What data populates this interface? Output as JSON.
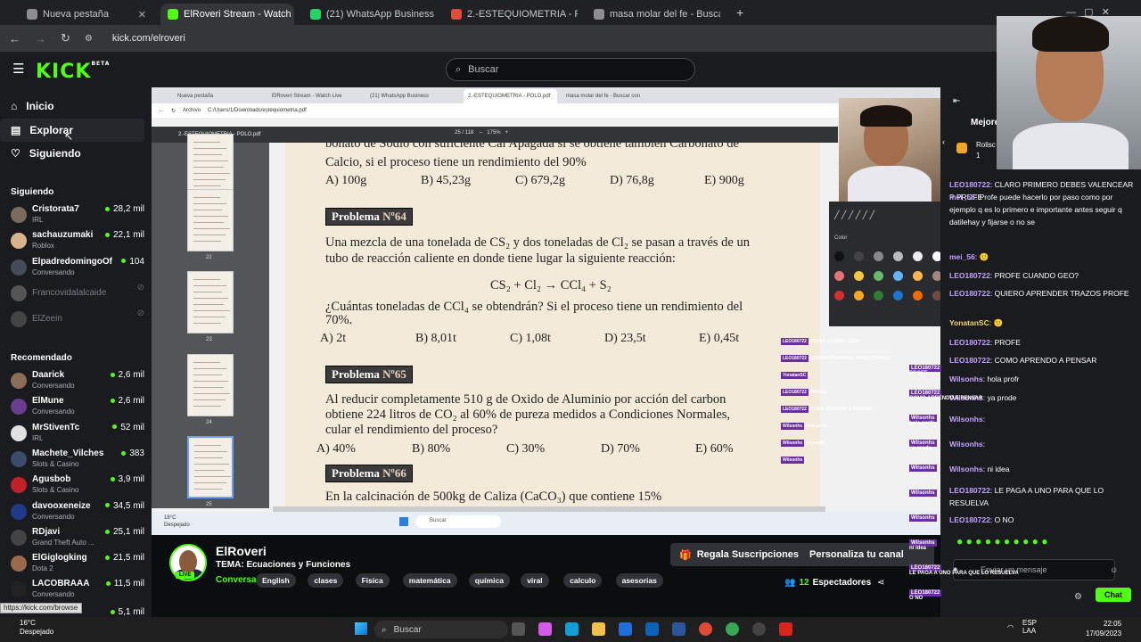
{
  "browser": {
    "tabs": [
      {
        "label": "Nueva pestaña",
        "color": "#8e8e8e"
      },
      {
        "label": "ElRoveri Stream - Watch Liv",
        "color": "#53fc18",
        "active": true
      },
      {
        "label": "(21) WhatsApp Business",
        "color": "#25d366"
      },
      {
        "label": "2.-ESTEQUIOMETRIA - POLO.pd",
        "color": "#e04b3a"
      },
      {
        "label": "masa molar del fe - Buscar con",
        "color": "#8e8e8e"
      }
    ],
    "url": "kick.com/elroveri"
  },
  "kick": {
    "logo": "KICK",
    "logo_beta": "BETA",
    "search_placeholder": "Buscar"
  },
  "sidebar": {
    "nav": [
      {
        "label": "Inicio"
      },
      {
        "label": "Explorar"
      },
      {
        "label": "Siguiendo"
      }
    ],
    "following_header": "Siguiendo",
    "following": [
      {
        "name": "Cristorata7",
        "cat": "IRL",
        "viewers": "28,2 mil",
        "color": "#7b6b5f"
      },
      {
        "name": "sachauzumaki",
        "cat": "Roblox",
        "viewers": "22,1 mil",
        "color": "#d8b38c"
      },
      {
        "name": "ElpadredomingoOf...",
        "cat": "Conversando",
        "viewers": "104",
        "color": "#444c5c"
      },
      {
        "name": "Francovidalalcaide",
        "offline": true,
        "color": "#555"
      },
      {
        "name": "ElZeein",
        "offline": true,
        "color": "#444"
      }
    ],
    "recommended_header": "Recomendado",
    "recommended": [
      {
        "name": "Daarick",
        "cat": "Conversando",
        "viewers": "2,6 mil",
        "color": "#8a6e58"
      },
      {
        "name": "ElMune",
        "cat": "Conversando",
        "viewers": "2,6 mil",
        "color": "#6b3d8e"
      },
      {
        "name": "MrStivenTc",
        "cat": "IRL",
        "viewers": "52 mil",
        "color": "#e0e0e0"
      },
      {
        "name": "Machete_Vilches",
        "cat": "Slots & Casino",
        "viewers": "383",
        "color": "#3a4c6a"
      },
      {
        "name": "Agusbob",
        "cat": "Slots & Casino",
        "viewers": "3,9 mil",
        "color": "#c3202a"
      },
      {
        "name": "davooxeneize",
        "cat": "Conversando",
        "viewers": "34,5 mil",
        "color": "#203a8a"
      },
      {
        "name": "RDjavi",
        "cat": "Grand Theft Auto ...",
        "viewers": "25,1 mil",
        "color": "#444"
      },
      {
        "name": "ElGiglogking",
        "cat": "Dota 2",
        "viewers": "21,5 mil",
        "color": "#9c6a4a"
      },
      {
        "name": "LACOBRAAA",
        "cat": "Conversando",
        "viewers": "11,5 mil",
        "color": "#222"
      }
    ],
    "cut_viewers": "5,1 mil",
    "status_url": "https://kick.com/browse"
  },
  "stream_screen": {
    "inner_tabs": [
      {
        "label": "Nueva pestaña"
      },
      {
        "label": "ElRoveri Stream - Watch Live"
      },
      {
        "label": "(21) WhatsApp Business"
      },
      {
        "label": "2.-ESTEQUIOMETRIA - POLO.pdf",
        "active": true
      },
      {
        "label": "masa molar del fe - Buscar con"
      }
    ],
    "inner_url": "C:/Users/1/Downloads/estequiometria.pdf",
    "inner_url_prefix": "Archivo",
    "pdf_title": "2.-ESTEQUIOMETRIA - POLO.pdf",
    "pdf_page": "25 / 118",
    "pdf_zoom": "175%",
    "thumb_numbers": [
      "21",
      "22",
      "23",
      "24",
      "25"
    ],
    "doc": {
      "line0": "bonato de Sodio con suficiente Cal Apagada si se obtiene también Carbonato de",
      "line1": "Calcio, si el proceso tiene un rendimiento del 90%",
      "ans1": [
        "A) 100g",
        "B) 45,23g",
        "C) 679,2g",
        "D) 76,8g",
        "E) 900g"
      ],
      "p64": {
        "label": "Problema",
        "num": "Nº64"
      },
      "p64_l1": "Una mezcla de una tonelada de CS₂ y dos toneladas de Cl₂ se pasan a través de un",
      "p64_l2": "tubo de reacción caliente en donde tiene lugar la siguiente reacción:",
      "reaction": "CS₂ + Cl₂  →  CCl₄ + S₂",
      "p64_l3": "¿Cuántas toneladas de CCl₄ se obtendrán? Si el proceso tiene un rendimiento del",
      "p64_l4": "70%.",
      "ans2": [
        "A) 2t",
        "B) 8,01t",
        "C) 1,08t",
        "D) 23,5t",
        "E) 0,45t"
      ],
      "p65": {
        "label": "Problema",
        "num": "Nº65"
      },
      "p65_l1": "Al reducir completamente 510 g de Oxido de Aluminio por acción del carbon",
      "p65_l2": "obtiene 224 litros de CO₂ al 60% de pureza medidos a Condiciones Normales,",
      "p65_l3": "cular el rendimiento del proceso?",
      "ans3": [
        "A) 40%",
        "B) 80%",
        "C) 30%",
        "D) 70%",
        "E) 60%"
      ],
      "p66": {
        "label": "Problema",
        "num": "Nº66"
      },
      "p66_l1": "En la calcinación de 500kg de Caliza (CaCO₃) que contiene 15%"
    },
    "color_label": "Color",
    "overlay_chat": [
      {
        "u": "LEO180722",
        "t": "PROFE CUANDO GEO?"
      },
      {
        "u": "LEO180722",
        "t": "QUIERO APRENDER TRAZOS PROFE"
      },
      {
        "u": "YonatanSC",
        "t": ""
      },
      {
        "u": "LEO180722",
        "t": "PROFE"
      },
      {
        "u": "LEO180722",
        "t": "COMO APRENDO A PENSAR"
      },
      {
        "u": "Wilsonhs",
        "t": "hola profr"
      },
      {
        "u": "Wilsonhs",
        "t": "ya prode"
      },
      {
        "u": "Wilsonhs",
        "t": ""
      }
    ],
    "inner_weather": "18°C",
    "inner_weather_desc": "Despejado",
    "inner_search": "Buscar"
  },
  "stream_info": {
    "streamer": "ElRoveri",
    "live": "LIVE",
    "title": "TEMA: Ecuaciones y Funciones",
    "category": "Conversando",
    "tags": [
      "English",
      "clases",
      "Física",
      "matemática",
      "química",
      "viral",
      "calculo",
      "asesorias"
    ],
    "gift_button": "Regala Suscripciones",
    "customize_button": "Personaliza tu canal",
    "viewers_count": "12",
    "viewers_label": "Espectadores"
  },
  "chat": {
    "header": "Mejore",
    "pinned_user": "Rolisc",
    "pinned_count": "1",
    "messages": [
      {
        "u": "LEO180722",
        "t": "CLARO PRIMERO DEBES VALENCEAR P PROFE"
      },
      {
        "u": "mei_56",
        "t": "Profe puede hacerlo por paso como por ejemplo q es lo primero e importante antes seguir q datilehay y fijarse o no se"
      },
      {
        "u": "mei_56",
        "t": "🙂",
        "g": true
      },
      {
        "u": "LEO180722",
        "t": "PROFE CUANDO GEO?"
      },
      {
        "u": "LEO180722",
        "t": "QUIERO APRENDER TRAZOS PROFE"
      },
      {
        "u": "YonatanSC",
        "t": "🙂",
        "gold": true
      },
      {
        "u": "LEO180722",
        "t": "PROFE"
      },
      {
        "u": "LEO180722",
        "t": "COMO APRENDO A PENSAR"
      },
      {
        "u": "Wilsonhs",
        "t": "hola profr"
      },
      {
        "u": "Wilsonhs",
        "t": "ya prode"
      },
      {
        "u": "Wilsonhs",
        "t": ""
      },
      {
        "u": "Wilsonhs",
        "t": ""
      },
      {
        "u": "Wilsonhs",
        "t": "ni idea"
      },
      {
        "u": "LEO180722",
        "t": "LE PAGA A UNO PARA QUE LO RESUELVA"
      },
      {
        "u": "LEO180722",
        "t": "O NO"
      }
    ],
    "input_placeholder": "Enviar un mensaje",
    "send_button": "Chat",
    "spam": [
      {
        "u": "LEO180722",
        "t": "PROFE"
      },
      {
        "u": "LEO180722",
        "t": "COMO APRENDO A PENSAR"
      },
      {
        "u": "Wilsonhs",
        "t": "hola profr"
      },
      {
        "u": "Wilsonhs",
        "t": "ya prode"
      },
      {
        "u": "Wilsonhs",
        "t": ""
      },
      {
        "u": "Wilsonhs",
        "t": ""
      },
      {
        "u": "Wilsonhs",
        "t": ""
      },
      {
        "u": "Wilsonhs",
        "t": "ni idea"
      },
      {
        "u": "LEO180722",
        "t": "LE PAGA A UNO PARA QUE LO RESUELVA"
      },
      {
        "u": "LEO180722",
        "t": "O NO"
      }
    ]
  },
  "taskbar": {
    "weather": "16°C",
    "weather_desc": "Despejado",
    "search": "Buscar",
    "lang": "ESP",
    "lang2": "LAA",
    "time": "22:05",
    "date": "17/09/2023"
  }
}
